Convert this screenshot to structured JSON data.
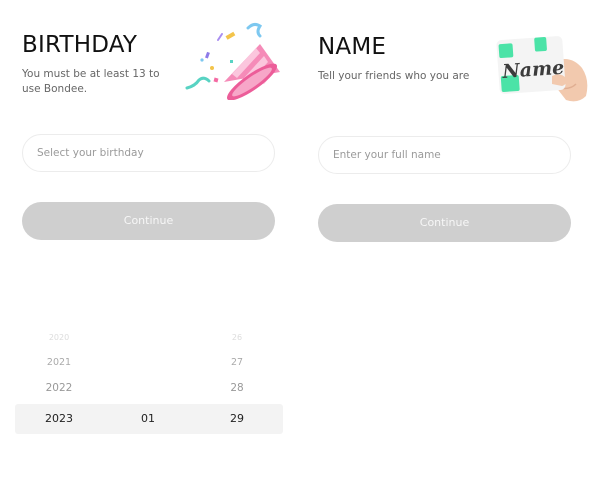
{
  "birthday": {
    "title": "BIRTHDAY",
    "subtitle": "You must be at least 13 to use Bondee.",
    "placeholder": "Select your birthday",
    "continue_label": "Continue",
    "picker": {
      "faint_row": {
        "year": "2020",
        "month": "",
        "day": "26"
      },
      "rows": [
        {
          "year": "2021",
          "month": "",
          "day": "27"
        },
        {
          "year": "2022",
          "month": "",
          "day": "28"
        }
      ],
      "selected": {
        "year": "2023",
        "month": "01",
        "day": "29"
      }
    }
  },
  "name": {
    "title": "NAME",
    "subtitle": "Tell your friends who you are",
    "placeholder": "Enter your full name",
    "continue_label": "Continue",
    "card_text": "Name"
  },
  "colors": {
    "button_disabled": "#cfcfcf",
    "title": "#111111",
    "card_green": "#4be3a7",
    "party_pink": "#f46aa3"
  }
}
